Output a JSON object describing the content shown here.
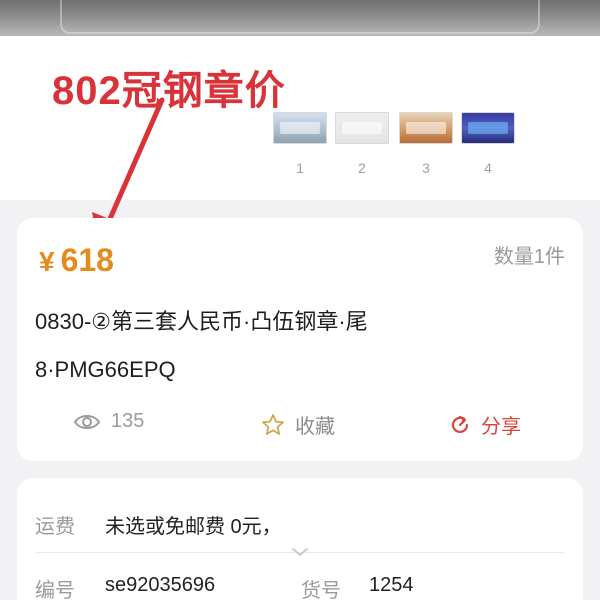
{
  "annotation": {
    "text": "802冠钢章价",
    "color": "#d9333a"
  },
  "gallery": {
    "thumbnails": [
      {
        "number": "1"
      },
      {
        "number": "2"
      },
      {
        "number": "3"
      },
      {
        "number": "4"
      }
    ]
  },
  "product": {
    "currency": "¥",
    "price": "618",
    "price_color": "#e58a1f",
    "quantity": "数量1件",
    "title_line1": "0830-②第三套人民币·凸伍钢章·尾",
    "title_line2": "8·PMG66EPQ",
    "views": "135",
    "favorite_label": "收藏",
    "share_label": "分享",
    "share_color": "#d9453e"
  },
  "details": {
    "shipping_label": "运费",
    "shipping_value": "未选或免邮费 0元，",
    "code_label": "编号",
    "code_value": "se92035696",
    "sku_label": "货号",
    "sku_value": "1254"
  }
}
